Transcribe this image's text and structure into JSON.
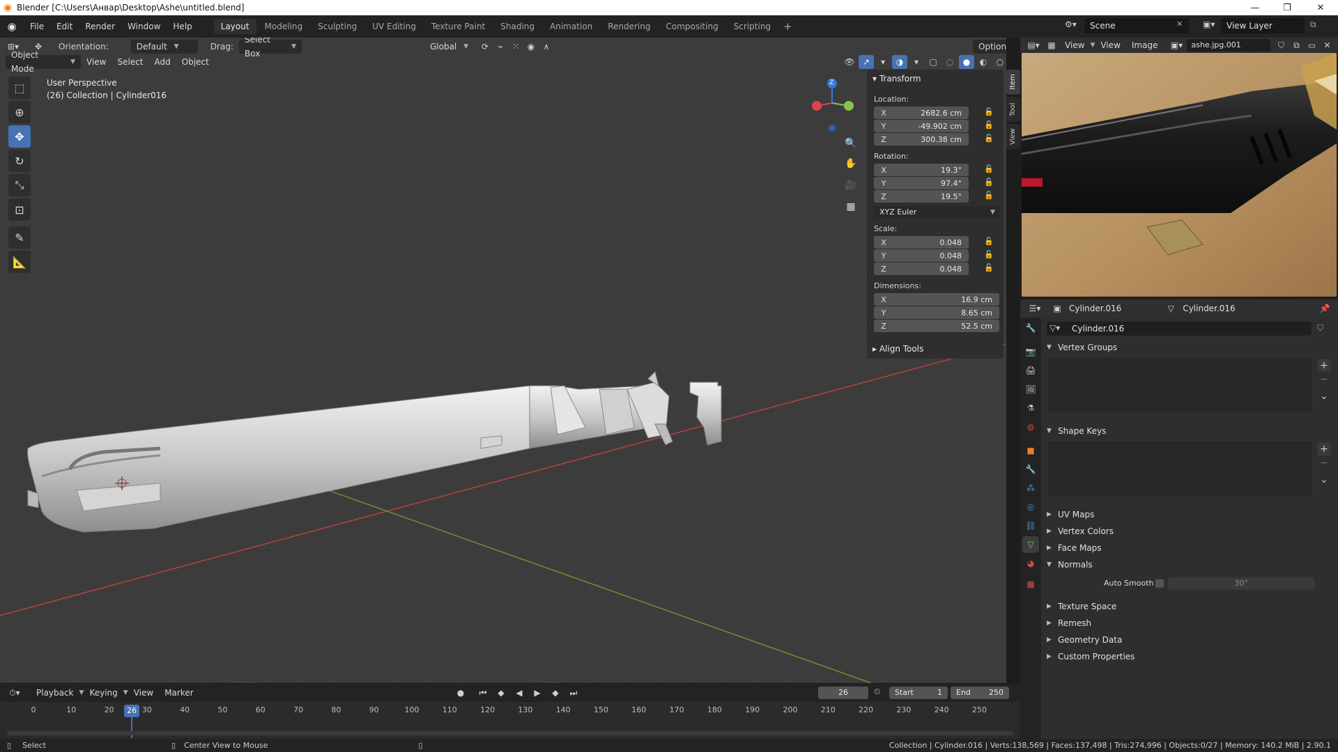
{
  "window": {
    "title": "Blender [C:\\Users\\Анвар\\Desktop\\Ashe\\untitled.blend]",
    "minimize": "—",
    "maximize": "❐",
    "close": "✕"
  },
  "menu": [
    "File",
    "Edit",
    "Render",
    "Window",
    "Help"
  ],
  "workspaces": [
    "Layout",
    "Modeling",
    "Sculpting",
    "UV Editing",
    "Texture Paint",
    "Shading",
    "Animation",
    "Rendering",
    "Compositing",
    "Scripting"
  ],
  "active_workspace": "Layout",
  "scene": {
    "name": "Scene",
    "view_layer": "View Layer"
  },
  "viewport": {
    "orientation_label": "Orientation:",
    "orientation_value": "Default",
    "drag_label": "Drag:",
    "drag_value": "Select Box",
    "transform_space": "Global",
    "options": "Options",
    "mode": "Object Mode",
    "view_menu": [
      "View",
      "Select",
      "Add",
      "Object"
    ],
    "info_line1": "User Perspective",
    "info_line2": "(26) Collection | Cylinder016",
    "gizmo": {
      "z_label": "Z"
    }
  },
  "npanel": {
    "tabs": [
      "Item",
      "Tool",
      "View"
    ],
    "transform_title": "Transform",
    "location_label": "Location:",
    "location": {
      "x": "2682.6 cm",
      "y": "-49.902 cm",
      "z": "300.38 cm"
    },
    "rotation_label": "Rotation:",
    "rotation": {
      "x": "19.3°",
      "y": "97.4°",
      "z": "19.5°"
    },
    "rotation_mode": "XYZ Euler",
    "scale_label": "Scale:",
    "scale": {
      "x": "0.048",
      "y": "0.048",
      "z": "0.048"
    },
    "dimensions_label": "Dimensions:",
    "dimensions": {
      "x": "16.9 cm",
      "y": "8.65 cm",
      "z": "52.5 cm"
    },
    "axis": {
      "x": "X",
      "y": "Y",
      "z": "Z"
    },
    "align_tools": "Align Tools"
  },
  "timeline": {
    "menus": [
      "Playback",
      "Keying",
      "View",
      "Marker"
    ],
    "current_frame": "26",
    "start_label": "Start",
    "start": "1",
    "end_label": "End",
    "end": "250",
    "ticks": [
      "0",
      "10",
      "20",
      "30",
      "40",
      "50",
      "60",
      "70",
      "80",
      "90",
      "100",
      "110",
      "120",
      "130",
      "140",
      "150",
      "160",
      "170",
      "180",
      "190",
      "200",
      "210",
      "220",
      "230",
      "240",
      "250"
    ]
  },
  "image_editor": {
    "menus": [
      "View",
      "View",
      "Image"
    ],
    "image_name": "ashe.jpg.001"
  },
  "properties": {
    "object_name": "Cylinder.016",
    "data_name": "Cylinder.016",
    "mesh_name": "Cylinder.016",
    "panels": {
      "vertex_groups": "Vertex Groups",
      "shape_keys": "Shape Keys",
      "uv_maps": "UV Maps",
      "vertex_colors": "Vertex Colors",
      "face_maps": "Face Maps",
      "normals": "Normals",
      "auto_smooth": "Auto Smooth",
      "auto_smooth_angle": "30°",
      "texture_space": "Texture Space",
      "remesh": "Remesh",
      "geometry_data": "Geometry Data",
      "custom_properties": "Custom Properties"
    }
  },
  "status": {
    "select": "Select",
    "center_view": "Center View to Mouse",
    "stats": "Collection | Cylinder.016 | Verts:138,569 | Faces:137,498 | Tris:274,996 | Objects:0/27 | Memory: 140.2 MiB | 2.90.1"
  },
  "colors": {
    "accent": "#4772b3",
    "x_axis": "#e0434d",
    "y_axis": "#8bc34a",
    "z_axis": "#2f7bdf"
  }
}
